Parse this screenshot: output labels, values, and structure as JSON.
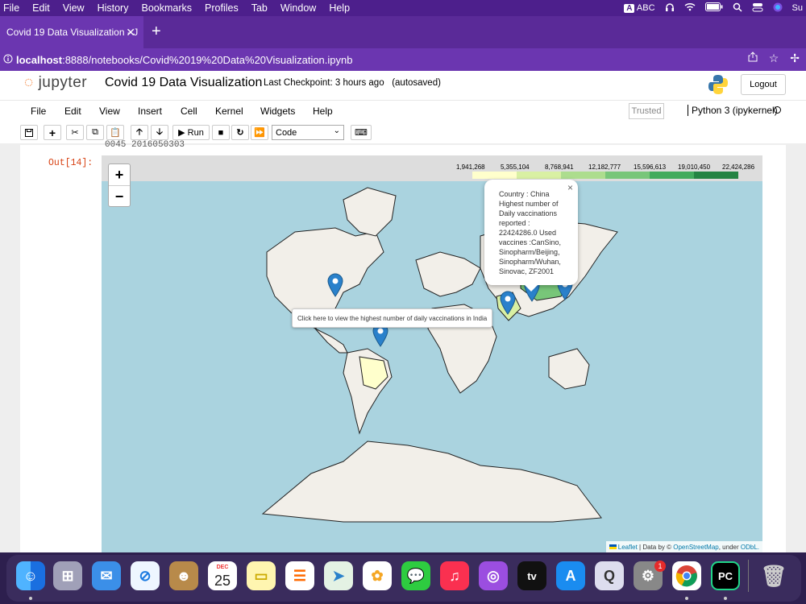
{
  "menubar": {
    "items": [
      "File",
      "Edit",
      "View",
      "History",
      "Bookmarks",
      "Profiles",
      "Tab",
      "Window",
      "Help"
    ],
    "input_source": "ABC",
    "input_badge": "A",
    "overflow_text": "Su"
  },
  "browser": {
    "tab_title": "Covid 19 Data Visualization - J",
    "url_host": "localhost",
    "url_path": ":8888/notebooks/Covid%2019%20Data%20Visualization.ipynb"
  },
  "jupyter": {
    "logo_text": "jupyter",
    "notebook_title": "Covid 19 Data Visualization",
    "checkpoint": "Last Checkpoint: 3 hours ago",
    "autosave": "(autosaved)",
    "logout_label": "Logout",
    "menu": [
      "File",
      "Edit",
      "View",
      "Insert",
      "Cell",
      "Kernel",
      "Widgets",
      "Help"
    ],
    "trusted_label": "Trusted",
    "kernel_name": "Python 3 (ipykernel)",
    "run_label": "Run",
    "cell_type": "Code",
    "out_prompt": "Out[14]:",
    "cutoff_text": "0045 2016050303"
  },
  "map": {
    "legend_ticks": [
      "1,941,268",
      "5,355,104",
      "8,768,941",
      "12,182,777",
      "15,596,613",
      "19,010,450",
      "22,424,286"
    ],
    "legend_colors": [
      "#ffffcc",
      "#d9f0a3",
      "#addd8e",
      "#78c679",
      "#41ab5d",
      "#238443"
    ],
    "zoom_in": "+",
    "zoom_out": "−",
    "popup_close": "×",
    "popup_lines": [
      "Country : China",
      "Highest number of",
      "Daily vaccinations",
      "reported :",
      "22424286.0 Used",
      "vaccines :CanSino,",
      "Sinopharm/Beijing,",
      "Sinopharm/Wuhan,",
      "Sinovac, ZF2001"
    ],
    "tooltip": "Click here to view the highest number of daily vaccinations in India",
    "attribution_leaflet": "Leaflet",
    "attribution_mid": " | Data by © ",
    "attribution_osm": "OpenStreetMap",
    "attribution_under": ", under ",
    "attribution_odbl": "ODbL."
  },
  "dock": {
    "calendar_month": "DEC",
    "calendar_day": "25",
    "badge_count": "1",
    "tv_label": "tv",
    "pc_label": "PC"
  }
}
